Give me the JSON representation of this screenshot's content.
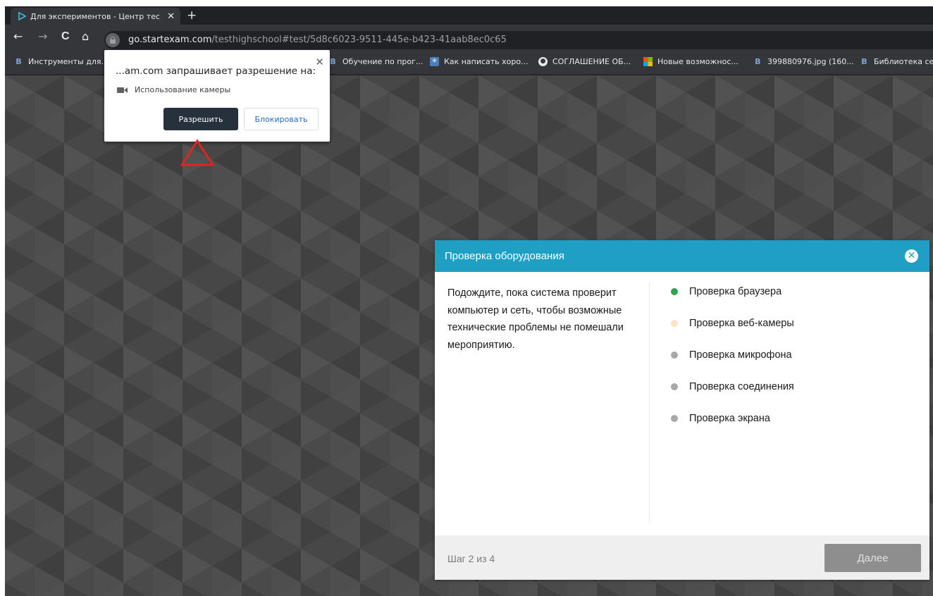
{
  "browser": {
    "tab": {
      "title": "Для экспериментов - Центр тес",
      "close": "✕"
    },
    "new_tab": "+",
    "nav": {
      "back": "←",
      "forward": "→",
      "reload": "C",
      "home": "⌂"
    },
    "url": {
      "host": "go.startexam.com",
      "path": "/testhighschool#test/5d8c6023-9511-445e-b423-41aab8ec0c65"
    },
    "bookmarks": [
      {
        "label": "Инструменты для...",
        "icon": "b-icon"
      },
      {
        "label": "Обучение по прог...",
        "icon": "b-icon"
      },
      {
        "label": "Как написать хоро...",
        "icon": "star-icon"
      },
      {
        "label": "СОГЛАШЕНИЕ ОБ...",
        "icon": "globe-icon"
      },
      {
        "label": "Новые возможнос...",
        "icon": "microsoft-icon"
      },
      {
        "label": "399880976.jpg (160...",
        "icon": "b-icon"
      },
      {
        "label": "Библиотека се",
        "icon": "b-icon"
      }
    ]
  },
  "permission": {
    "title": "...am.com запрашивает разрешение на:",
    "item": "Использование камеры",
    "allow": "Разрешить",
    "block": "Блокировать",
    "close": "✕"
  },
  "dialog": {
    "title": "Проверка оборудования",
    "close": "✕",
    "message": "Подождите, пока система проверит компьютер и сеть, чтобы возможные технические проблемы не помешали мероприятию.",
    "checks": [
      {
        "label": "Проверка браузера",
        "status": "done",
        "color": "#2ea44f"
      },
      {
        "label": "Проверка веб-камеры",
        "status": "in-progress",
        "color": "#fde5c2"
      },
      {
        "label": "Проверка микрофона",
        "status": "pending",
        "color": "#a8a8a8"
      },
      {
        "label": "Проверка соединения",
        "status": "pending",
        "color": "#a8a8a8"
      },
      {
        "label": "Проверка экрана",
        "status": "pending",
        "color": "#a8a8a8"
      }
    ],
    "step": "Шаг 2 из 4",
    "next": "Далее"
  },
  "colors": {
    "accent": "#1e9fc3",
    "annotation": "#e02424",
    "page_bg": "#474747"
  }
}
